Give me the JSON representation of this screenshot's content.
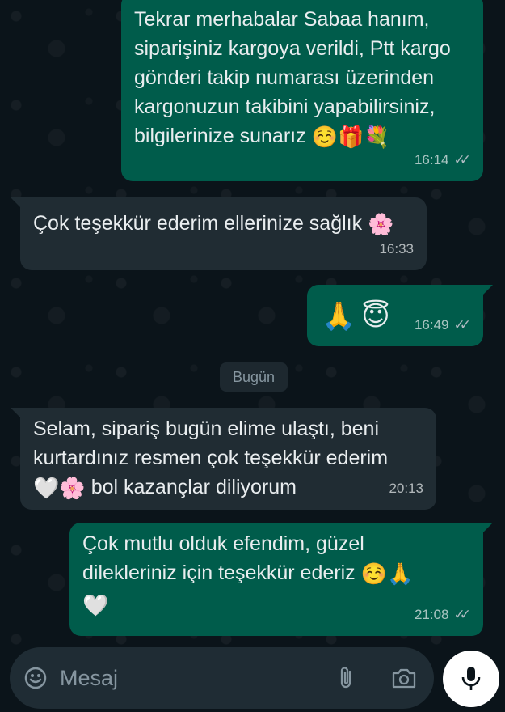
{
  "messages": [
    {
      "direction": "outgoing",
      "text_lines": [
        "Tekrar merhabalar Sabaa hanım,",
        "siparişiniz kargoya verildi, Ptt kargo",
        "gönderi takip numarası üzerinden",
        "kargonuzun takibini yapabilirsiniz,",
        "bilgilerinize sunarız"
      ],
      "emojis": [
        "☺️",
        "🎁",
        "💐"
      ],
      "time": "16:14",
      "status": "read"
    },
    {
      "direction": "incoming",
      "text_lines": [
        "Çok teşekkür ederim ellerinize sağlık"
      ],
      "emojis": [
        "🌸"
      ],
      "time": "16:33"
    },
    {
      "direction": "outgoing",
      "text_lines": [],
      "emojis": [
        "🙏",
        "😇"
      ],
      "time": "16:49",
      "status": "read"
    },
    {
      "direction": "incoming",
      "text_lines": [
        "Selam, sipariş bugün elime ulaştı, beni",
        "kurtardınız resmen çok teşekkür ederim",
        "bol kazançlar diliyorum"
      ],
      "emojis": [
        "🤍",
        "🌸"
      ],
      "time": "20:13"
    },
    {
      "direction": "outgoing",
      "text_lines": [
        "Çok mutlu olduk efendim, güzel",
        "dilekleriniz için teşekkür ederiz"
      ],
      "emojis": [
        "☺️",
        "🙏",
        "🤍"
      ],
      "time": "21:08",
      "status": "read"
    }
  ],
  "date_separator": "Bugün",
  "composer": {
    "placeholder": "Mesaj",
    "icons": [
      "emoji-icon",
      "attach-icon",
      "camera-icon",
      "mic-icon"
    ]
  },
  "colors": {
    "background": "#0b141a",
    "outgoing_bubble": "#005c4b",
    "incoming_bubble": "#202c33",
    "composer": "#1f2c34"
  }
}
